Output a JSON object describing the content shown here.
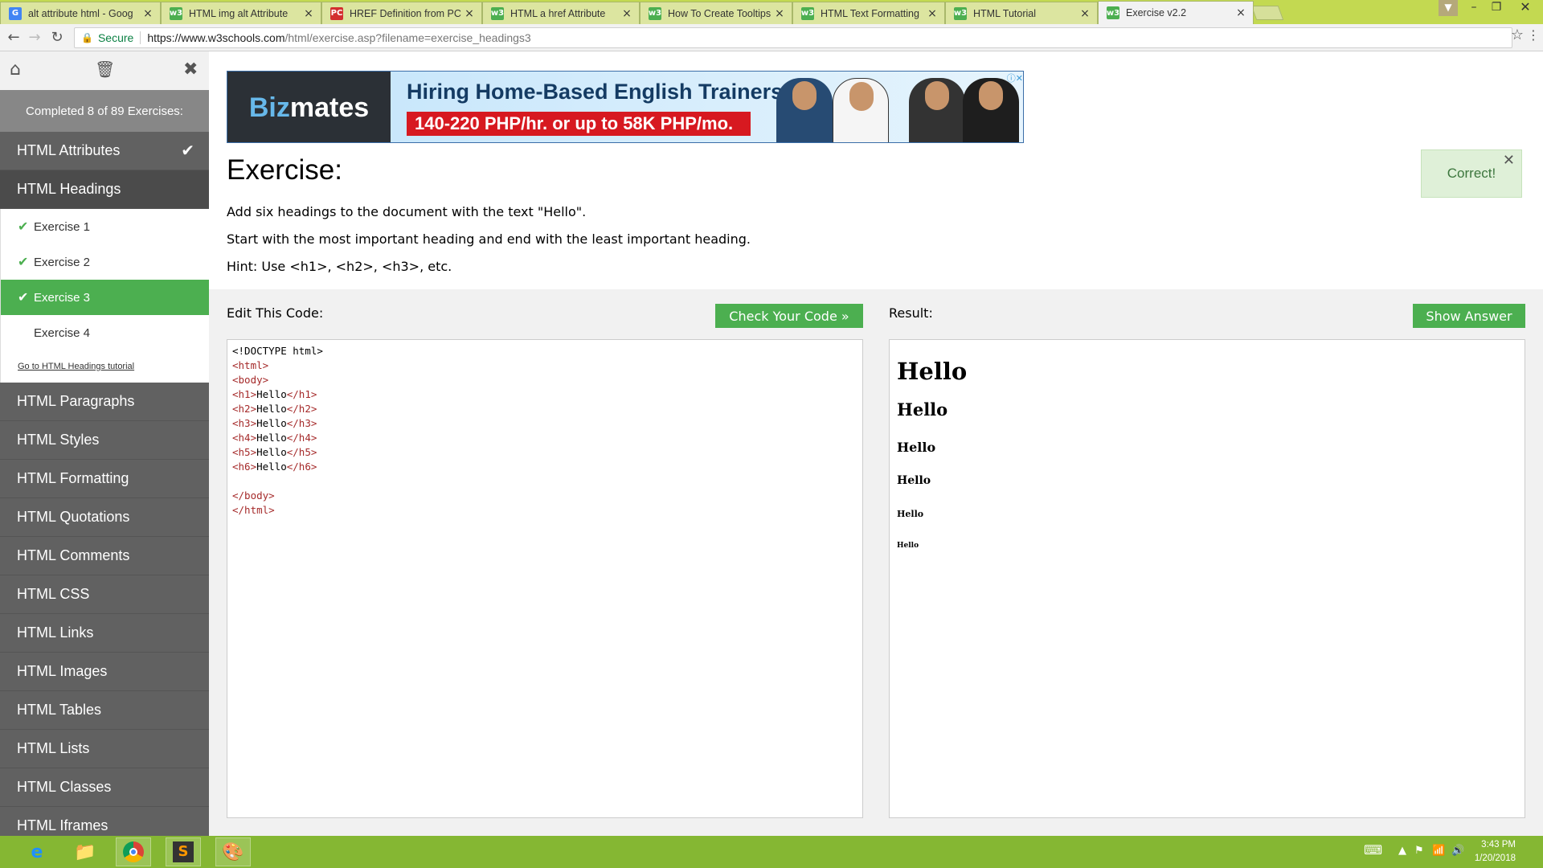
{
  "tabs": [
    {
      "title": "alt attribute html - Goog",
      "favicon": "G",
      "color": "#4285f4",
      "active": false
    },
    {
      "title": "HTML img alt Attribute",
      "favicon": "w3",
      "color": "#4caf50",
      "active": false
    },
    {
      "title": "HREF Definition from PC",
      "favicon": "PC",
      "color": "#d32f2f",
      "active": false
    },
    {
      "title": "HTML a href Attribute",
      "favicon": "w3",
      "color": "#4caf50",
      "active": false
    },
    {
      "title": "How To Create Tooltips",
      "favicon": "w3",
      "color": "#4caf50",
      "active": false
    },
    {
      "title": "HTML Text Formatting",
      "favicon": "w3",
      "color": "#4caf50",
      "active": false
    },
    {
      "title": "HTML Tutorial",
      "favicon": "w3",
      "color": "#4caf50",
      "active": false
    },
    {
      "title": "Exercise v2.2",
      "favicon": "w3",
      "color": "#4caf50",
      "active": true
    }
  ],
  "address_bar": {
    "secure_label": "Secure",
    "url_host": "https://www.w3schools.com",
    "url_path": "/html/exercise.asp?filename=exercise_headings3"
  },
  "sidebar": {
    "progress": "Completed 8 of 89 Exercises:",
    "topics_before": [
      {
        "label": "HTML Attributes",
        "completed": true
      },
      {
        "label": "HTML Headings",
        "completed": false,
        "open": true
      }
    ],
    "exercises": [
      {
        "label": "Exercise 1",
        "done": true,
        "active": false
      },
      {
        "label": "Exercise 2",
        "done": true,
        "active": false
      },
      {
        "label": "Exercise 3",
        "done": true,
        "active": true
      },
      {
        "label": "Exercise 4",
        "done": false,
        "active": false
      }
    ],
    "tutorial_link": "Go to HTML Headings tutorial",
    "topics_after": [
      "HTML Paragraphs",
      "HTML Styles",
      "HTML Formatting",
      "HTML Quotations",
      "HTML Comments",
      "HTML CSS",
      "HTML Links",
      "HTML Images",
      "HTML Tables",
      "HTML Lists",
      "HTML Classes",
      "HTML Iframes"
    ]
  },
  "ad": {
    "brand_a": "Biz",
    "brand_b": "mates",
    "headline": "Hiring Home-Based English Trainers!",
    "subline": "140-220 PHP/hr. or up to 58K PHP/mo."
  },
  "exercise": {
    "title": "Exercise:",
    "line1": "Add six headings to the document with the text \"Hello\".",
    "line2": "Start with the most important heading and end with the least important heading.",
    "line3": "Hint: Use <h1>, <h2>, <h3>, etc.",
    "toast": "Correct!"
  },
  "editor": {
    "label": "Edit This Code:",
    "check_button": "Check Your Code »",
    "lines": [
      {
        "text": "<!DOCTYPE html>",
        "kind": "plain"
      },
      {
        "text": "<html>",
        "kind": "tag"
      },
      {
        "text": "<body>",
        "kind": "tag"
      },
      {
        "open": "<h1>",
        "inner": "Hello",
        "close": "</h1>",
        "kind": "elem"
      },
      {
        "open": "<h2>",
        "inner": "Hello",
        "close": "</h2>",
        "kind": "elem"
      },
      {
        "open": "<h3>",
        "inner": "Hello",
        "close": "</h3>",
        "kind": "elem"
      },
      {
        "open": "<h4>",
        "inner": "Hello",
        "close": "</h4>",
        "kind": "elem"
      },
      {
        "open": "<h5>",
        "inner": "Hello",
        "close": "</h5>",
        "kind": "elem"
      },
      {
        "open": "<h6>",
        "inner": "Hello",
        "close": "</h6>",
        "kind": "elem"
      },
      {
        "text": "",
        "kind": "plain"
      },
      {
        "text": "</body>",
        "kind": "tag"
      },
      {
        "text": "</html>",
        "kind": "tag"
      }
    ]
  },
  "result": {
    "label": "Result:",
    "show_answer_button": "Show Answer",
    "headings": [
      "Hello",
      "Hello",
      "Hello",
      "Hello",
      "Hello",
      "Hello"
    ]
  },
  "taskbar": {
    "time": "3:43 PM",
    "date": "1/20/2018"
  },
  "colors": {
    "tab_strip": "#c3d951",
    "sidebar": "#616161",
    "accent_green": "#4caf50",
    "taskbar": "#85b733"
  }
}
